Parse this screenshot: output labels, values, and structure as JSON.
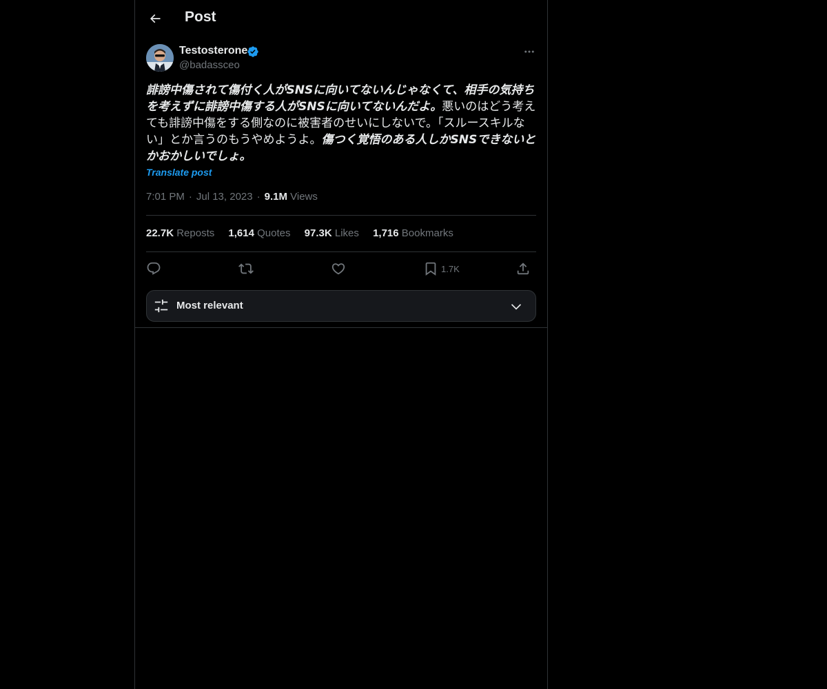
{
  "header": {
    "title": "Post"
  },
  "author": {
    "name": "Testosterone",
    "handle": "@badassceo"
  },
  "post": {
    "segments": [
      {
        "text": "誹謗中傷されて傷付く人がSNSに向いてないんじゃなくて、相手の気持ちを考えずに誹謗中傷する人がSNSに向いてないんだよ。",
        "emphasis": true
      },
      {
        "text": "悪いのはどう考えても誹謗中傷をする側なのに被害者のせいにしないで。「スルースキルない」とか言うのもうやめようよ。",
        "emphasis": false
      },
      {
        "text": "傷つく覚悟のある人しかSNSできないとかおかしいでしょ。",
        "emphasis": true
      }
    ],
    "translate_label": "Translate post",
    "time": "7:01 PM",
    "date": "Jul 13, 2023",
    "views_count": "9.1M",
    "views_label": "Views",
    "separator": "·"
  },
  "stats": {
    "reposts": {
      "count": "22.7K",
      "label": "Reposts"
    },
    "quotes": {
      "count": "1,614",
      "label": "Quotes"
    },
    "likes": {
      "count": "97.3K",
      "label": "Likes"
    },
    "bookmarks": {
      "count": "1,716",
      "label": "Bookmarks"
    }
  },
  "actions": {
    "reply_icon": "reply-icon",
    "repost_icon": "repost-icon",
    "like_icon": "heart-icon",
    "bookmark_icon": "bookmark-icon",
    "bookmark_count": "1.7K",
    "share_icon": "share-icon"
  },
  "sort": {
    "label": "Most relevant"
  },
  "colors": {
    "background": "#000000",
    "text": "#e7e9ea",
    "muted": "#71767b",
    "accent": "#1d9bf0",
    "border": "#2f3336"
  }
}
